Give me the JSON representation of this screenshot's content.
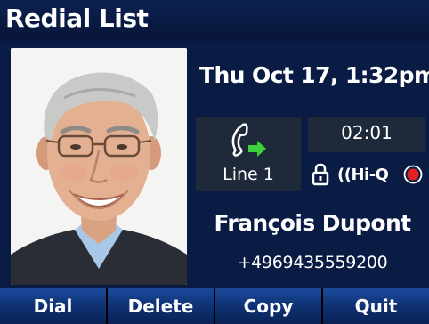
{
  "header": {
    "title": "Redial List"
  },
  "call": {
    "datetime": "Thu Oct 17, 1:32pm",
    "line_label": "Line 1",
    "timer": "02:01",
    "hiq_label": "((Hi-Q",
    "contact_name": "François Dupont",
    "contact_number": "+4969435559200"
  },
  "icons": {
    "line": "handset-incoming-arrow-icon",
    "secure": "lock-icon",
    "audio": "hd-voice-icon",
    "record": "record-icon"
  },
  "colors": {
    "header_bg": "#0c2050",
    "body_bg": "#0a1c44",
    "box_bg": "#1e2a3a",
    "softkey_bg": "#0e3070",
    "arrow_green": "#3ad13a",
    "record_red": "#e52020"
  },
  "softkeys": [
    {
      "label": "Dial"
    },
    {
      "label": "Delete"
    },
    {
      "label": "Copy"
    },
    {
      "label": "Quit"
    }
  ]
}
